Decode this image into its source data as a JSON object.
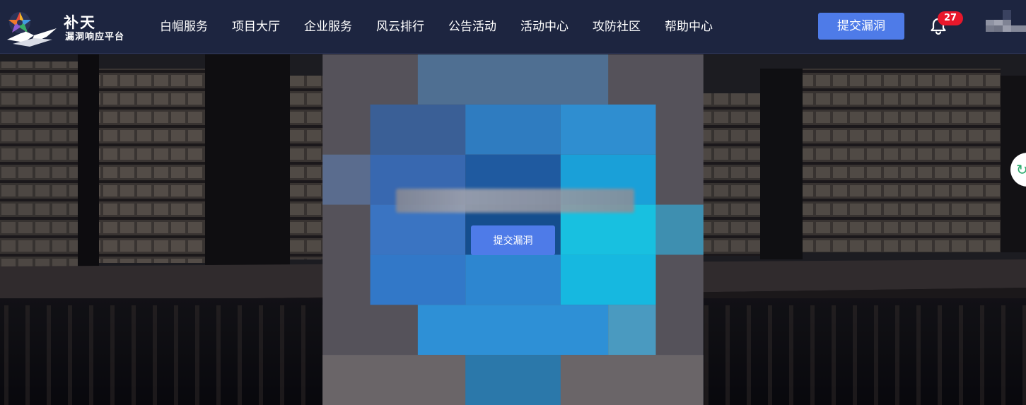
{
  "logo": {
    "title": "补天",
    "subtitle": "漏洞响应平台"
  },
  "nav": [
    {
      "label": "白帽服务"
    },
    {
      "label": "项目大厅"
    },
    {
      "label": "企业服务"
    },
    {
      "label": "风云排行"
    },
    {
      "label": "公告活动"
    },
    {
      "label": "活动中心"
    },
    {
      "label": "攻防社区"
    },
    {
      "label": "帮助中心"
    }
  ],
  "header": {
    "submit_label": "提交漏洞",
    "notification_count": "27"
  },
  "hero": {
    "submit_label": "提交漏洞"
  },
  "icons": {
    "bell": "bell-icon",
    "side": "refresh-icon"
  },
  "colors": {
    "header_bg": "#1d2540",
    "accent": "#4e7be8",
    "badge": "#e8172b"
  }
}
